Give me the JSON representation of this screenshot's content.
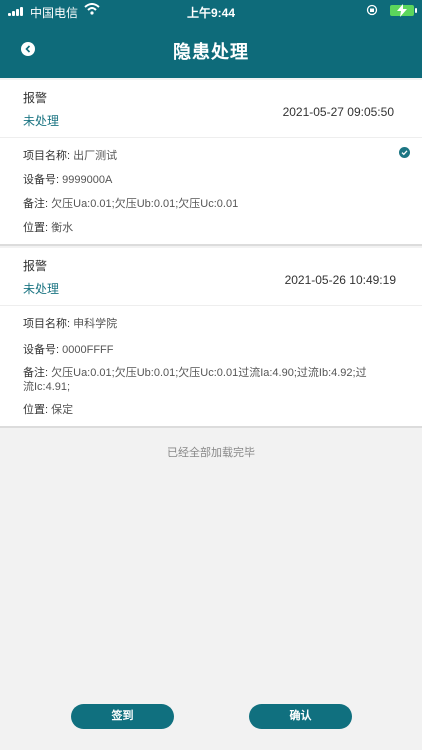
{
  "status_bar": {
    "carrier": "中国电信",
    "time": "上午9:44"
  },
  "header": {
    "title": "隐患处理"
  },
  "records": [
    {
      "type": "报警",
      "state": "未处理",
      "time": "2021-05-27 09:05:50",
      "project_label": "项目名称:",
      "project": "出厂测试",
      "device_label": "设备号:",
      "device": "9999000A",
      "note_label": "备注:",
      "note": "欠压Ua:0.01;欠压Ub:0.01;欠压Uc:0.01",
      "location_label": "位置:",
      "location": "衡水"
    },
    {
      "type": "报警",
      "state": "未处理",
      "time": "2021-05-26 10:49:19",
      "project_label": "项目名称:",
      "project": "申科学院",
      "device_label": "设备号:",
      "device": "0000FFFF",
      "note_label": "备注:",
      "note": "欠压Ua:0.01;欠压Ub:0.01;欠压Uc:0.01过流Ia:4.90;过流Ib:4.92;过流Ic:4.91;",
      "location_label": "位置:",
      "location": "保定"
    }
  ],
  "list_end_text": "已经全部加载完毕",
  "buttons": {
    "sign_in": "签到",
    "confirm": "确认"
  },
  "colors": {
    "header_bg": "#0e6b7a",
    "accent": "#1c7583",
    "button_bg": "#10707f"
  }
}
